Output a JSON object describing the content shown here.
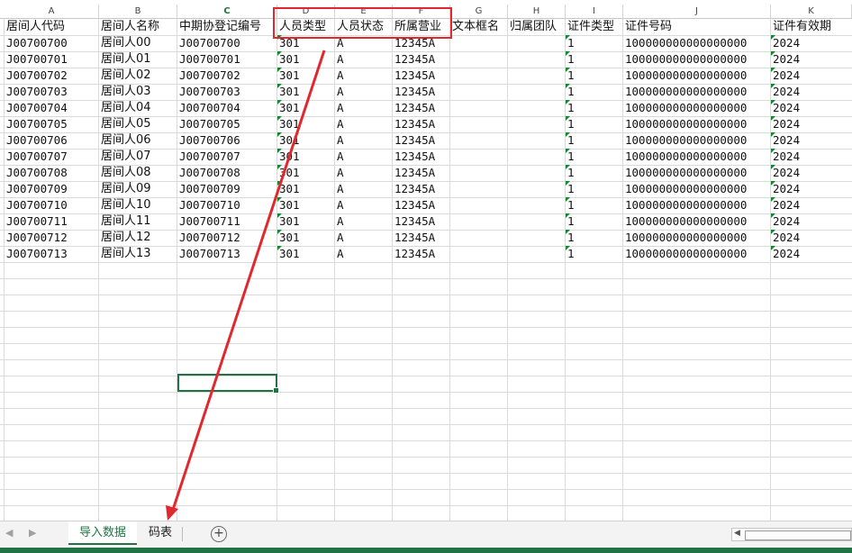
{
  "columns": [
    {
      "letter": "A",
      "header": "居间人代码"
    },
    {
      "letter": "B",
      "header": "居间人名称"
    },
    {
      "letter": "C",
      "header": "中期协登记编号"
    },
    {
      "letter": "D",
      "header": "人员类型"
    },
    {
      "letter": "E",
      "header": "人员状态"
    },
    {
      "letter": "F",
      "header": "所属营业"
    },
    {
      "letter": "G",
      "header": "文本框名"
    },
    {
      "letter": "H",
      "header": "归属团队"
    },
    {
      "letter": "I",
      "header": "证件类型"
    },
    {
      "letter": "J",
      "header": "证件号码"
    },
    {
      "letter": "K",
      "header": "证件有效期"
    }
  ],
  "rows": [
    [
      "J00700700",
      "居间人00",
      "J00700700",
      "301",
      "A",
      "12345A",
      "",
      "",
      "1",
      "100000000000000000",
      "2024"
    ],
    [
      "J00700701",
      "居间人01",
      "J00700701",
      "301",
      "A",
      "12345A",
      "",
      "",
      "1",
      "100000000000000000",
      "2024"
    ],
    [
      "J00700702",
      "居间人02",
      "J00700702",
      "301",
      "A",
      "12345A",
      "",
      "",
      "1",
      "100000000000000000",
      "2024"
    ],
    [
      "J00700703",
      "居间人03",
      "J00700703",
      "301",
      "A",
      "12345A",
      "",
      "",
      "1",
      "100000000000000000",
      "2024"
    ],
    [
      "J00700704",
      "居间人04",
      "J00700704",
      "301",
      "A",
      "12345A",
      "",
      "",
      "1",
      "100000000000000000",
      "2024"
    ],
    [
      "J00700705",
      "居间人05",
      "J00700705",
      "301",
      "A",
      "12345A",
      "",
      "",
      "1",
      "100000000000000000",
      "2024"
    ],
    [
      "J00700706",
      "居间人06",
      "J00700706",
      "301",
      "A",
      "12345A",
      "",
      "",
      "1",
      "100000000000000000",
      "2024"
    ],
    [
      "J00700707",
      "居间人07",
      "J00700707",
      "301",
      "A",
      "12345A",
      "",
      "",
      "1",
      "100000000000000000",
      "2024"
    ],
    [
      "J00700708",
      "居间人08",
      "J00700708",
      "301",
      "A",
      "12345A",
      "",
      "",
      "1",
      "100000000000000000",
      "2024"
    ],
    [
      "J00700709",
      "居间人09",
      "J00700709",
      "301",
      "A",
      "12345A",
      "",
      "",
      "1",
      "100000000000000000",
      "2024"
    ],
    [
      "J00700710",
      "居间人10",
      "J00700710",
      "301",
      "A",
      "12345A",
      "",
      "",
      "1",
      "100000000000000000",
      "2024"
    ],
    [
      "J00700711",
      "居间人11",
      "J00700711",
      "301",
      "A",
      "12345A",
      "",
      "",
      "1",
      "100000000000000000",
      "2024"
    ],
    [
      "J00700712",
      "居间人12",
      "J00700712",
      "301",
      "A",
      "12345A",
      "",
      "",
      "1",
      "100000000000000000",
      "2024"
    ],
    [
      "J00700713",
      "居间人13",
      "J00700713",
      "301",
      "A",
      "12345A",
      "",
      "",
      "1",
      "100000000000000000",
      "2024"
    ]
  ],
  "selected_column": "C",
  "sheet_tabs": {
    "active": "导入数据",
    "other": "码表",
    "add_icon": "plus-circle-icon",
    "nav_prev_icon": "caret-left-icon",
    "nav_next_icon": "caret-right-icon"
  },
  "annotation": {
    "highlight_color": "#e0282e",
    "highlighted_columns": [
      "D",
      "E",
      "F"
    ],
    "arrow_target": "码表"
  },
  "colors": {
    "accent": "#217346",
    "text_flag": "#0e8a2e"
  }
}
